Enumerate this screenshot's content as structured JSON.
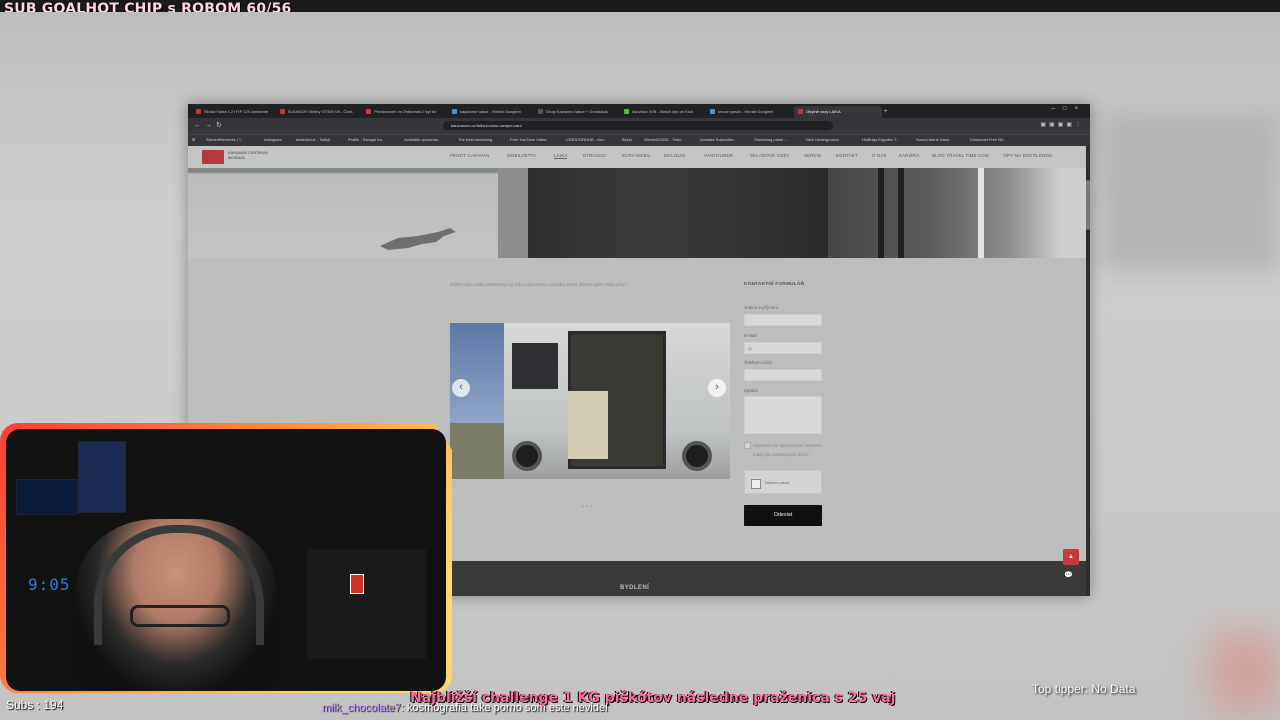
{
  "stream": {
    "sub_goal": "SUB GOALHOT CHIP s ROBOM 60/56",
    "subs": "Subs : 194",
    "challenge": "Najbližší challenge 1 KG piškótov následne praženica s 25 vaj",
    "chat_user": "milk_chocolate7",
    "chat_message": ": kosmografia take porno som este nevidel",
    "top_tipper": "Top tipper: No Data",
    "webcam_digits": "9:05"
  },
  "browser": {
    "tabs": [
      {
        "label": "Škoda Fabia 1.2 HTP 12V Ambiente",
        "color": "#c0392b"
      },
      {
        "label": "ELEANOR Shelby GT500 V8 - Čistá",
        "color": "#c0392b"
      },
      {
        "label": "Předsezonní vs Ordinerals 2 byl tot",
        "color": "#d33"
      },
      {
        "label": "kaplanme taboe - Hledat Googlem",
        "color": "#4a90d9"
      },
      {
        "label": "Drugi Kaplanno taboe + Geofadula",
        "color": "#333"
      },
      {
        "label": "kdovlxka IVIB - Watch dyn on Kick",
        "color": "#53c22b"
      },
      {
        "label": "known grado - Hledat Googlem",
        "color": "#4a90d9"
      },
      {
        "label": "Obytné vozy LAIKA",
        "color": "#c33"
      }
    ],
    "url": "karavancm.cz/laika-kosmo-camper-van/",
    "bookmarks": [
      "StreamElements | T..",
      "Instagram",
      "lekabbrook - Twitch",
      "Profile - Escape fro..",
      "Available operando..",
      "The best streaming..",
      "Free YouTube Video..",
      "CREATORHUB - Acc..",
      "Bkeyr",
      "StreamDOGE - Twitc..",
      "Animate Subscribe..",
      "Streaming panel -..",
      "New Underground..",
      "HisBriga Ergodex T..",
      "Sound Alerts Dash..",
      "Download Free Bli.."
    ]
  },
  "site": {
    "logo_text": "KARAVAN CENTRUM MORAVA",
    "nav": [
      "PENOT CARAVAN",
      "MOBILVETTA",
      "LAIKA",
      "ETRUSCO",
      "EURA MOBIL",
      "MCLOUIS",
      "VANTOURER",
      "SKLADOVÉ VOZY",
      "SERVIS",
      "KONTAKT",
      "O NÁS",
      "KARIÉRA",
      "BLOG TRAVEL TIME CCM",
      "TIPY NA DOVOLENOU"
    ],
    "intro": "Sdělte nám Vaše představy my Vám připravíme nabídku, která přesně splní Vaše přání",
    "form": {
      "title": "KONTAKTNÍ FORMULÁŘ",
      "name_label": "Jméno a příjmení",
      "email_label": "E-mail",
      "email_placeholder": "@",
      "phone_label": "Telefonní číslo",
      "message_label": "Zpráva",
      "consent": "Souhlasím se zpracováním osobních údajů pro marketingové účely *",
      "captcha": "Nejsem robot",
      "submit": "Odeslat"
    },
    "footer_label": "BYDLENÍ"
  }
}
